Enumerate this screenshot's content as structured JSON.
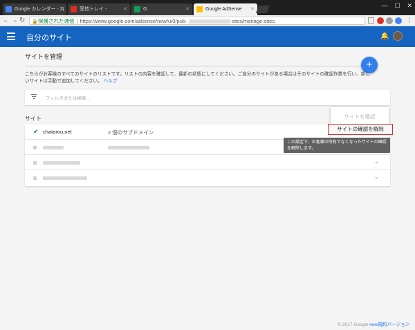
{
  "browser": {
    "tabs": [
      {
        "title": "Google カレンダー - 2(",
        "favicon_color": "#4285f4"
      },
      {
        "title": "受信トレイ -",
        "favicon_color": "#d93025"
      },
      {
        "title": "G",
        "favicon_color": "#0f9d58"
      },
      {
        "title": "Google AdSense",
        "favicon_color": "#fbbc04"
      }
    ],
    "address": {
      "secure_label": "保護された通信",
      "url_prefix": "https://www.google.com/adsense/new/u/0/pub-",
      "url_suffix": "sites/manage-sites"
    }
  },
  "app": {
    "title": "自分のサイト",
    "accent_color": "#1565c0"
  },
  "page": {
    "section_title": "サイトを管理",
    "fab_label": "+",
    "description": "こちらがお客様のすべてのサイトのリストです。リストの内容を確認して、最新の状態にしてください。ご自分のサイトがある場合はそのサイトの確認作業を行い、新しいサイトは手動で追加してください。",
    "help_link": "ヘルプ",
    "filter_placeholder": "フィルタまたは検索...",
    "sites_label": "サイト",
    "rows": [
      {
        "name": "chatarou.net",
        "subdomains": "2 個のサブドメイン",
        "verified": true
      }
    ],
    "menu": {
      "verify_label": "サイトを確認",
      "unverify_label": "サイトの確認を解除"
    },
    "tooltip": "この設定で、お客様の所有でなくなったサイトの確認を解除します。",
    "footer": {
      "copyright": "© 2017 Google",
      "link": "new規約バージョン"
    }
  }
}
